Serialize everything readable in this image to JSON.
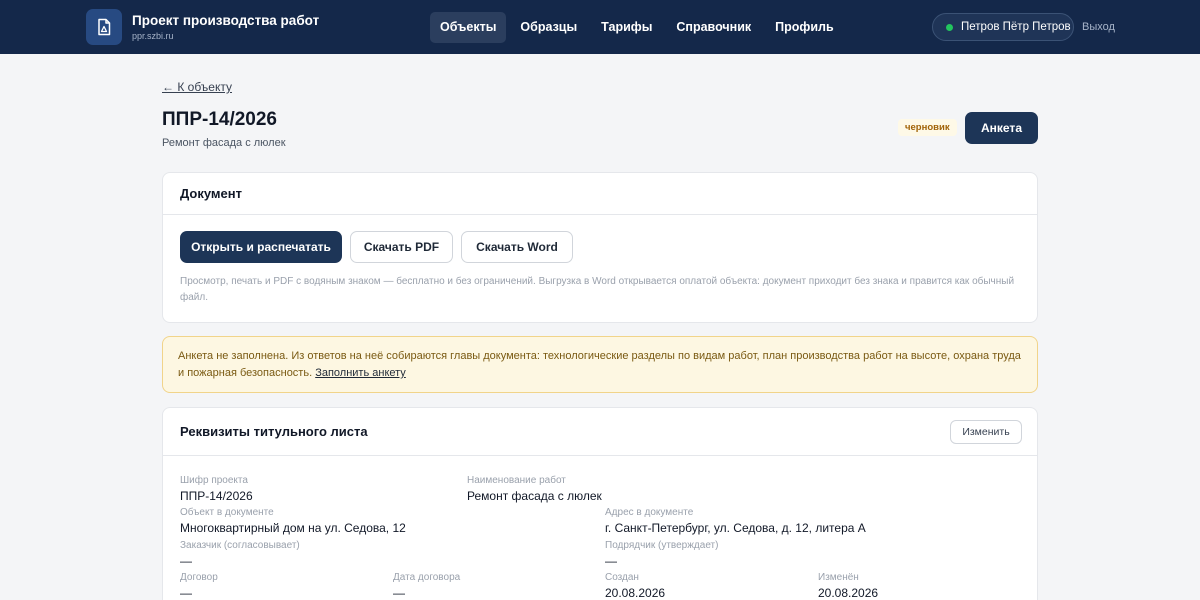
{
  "header": {
    "brand_title": "Проект производства работ",
    "brand_sub": "ppr.szbi.ru",
    "nav": [
      {
        "label": "Объекты",
        "active": true
      },
      {
        "label": "Образцы"
      },
      {
        "label": "Тарифы"
      },
      {
        "label": "Справочник"
      },
      {
        "label": "Профиль"
      }
    ],
    "user_name": "Петров Пётр Петров",
    "logout": "Выход"
  },
  "page": {
    "back": "← К объекту",
    "title": "ППР-14/2026",
    "subtitle": "Ремонт фасада с люлек",
    "status_badge": "черновик",
    "anketa_button": "Анкета"
  },
  "document": {
    "heading": "Документ",
    "open_print": "Открыть и распечатать",
    "download_pdf": "Скачать PDF",
    "download_word": "Скачать Word",
    "note": "Просмотр, печать и PDF с водяным знаком — бесплатно и без ограничений. Выгрузка в Word открывается оплатой объекта: документ приходит без знака и правится как обычный файл."
  },
  "warning": {
    "text": "Анкета не заполнена. Из ответов на неё собираются главы документа: технологические разделы по видам работ, план производства работ на высоте, охрана труда и пожарная безопасность.",
    "link": "Заполнить анкету"
  },
  "requisites": {
    "heading": "Реквизиты титульного листа",
    "edit_button": "Изменить",
    "fields": {
      "cipher": {
        "label": "Шифр проекта",
        "value": "ППР-14/2026"
      },
      "work_name": {
        "label": "Наименование работ",
        "value": "Ремонт фасада с люлек"
      },
      "object": {
        "label": "Объект в документе",
        "value": "Многоквартирный дом на ул. Седова, 12"
      },
      "address": {
        "label": "Адрес в документе",
        "value": "г. Санкт-Петербург, ул. Седова, д. 12, литера А"
      },
      "customer": {
        "label": "Заказчик (согласовывает)",
        "value": "—"
      },
      "contractor": {
        "label": "Подрядчик (утверждает)",
        "value": "—"
      },
      "contract": {
        "label": "Договор",
        "value": "—"
      },
      "contract_date": {
        "label": "Дата договора",
        "value": "—"
      },
      "created": {
        "label": "Создан",
        "value": "20.08.2026"
      },
      "modified": {
        "label": "Изменён",
        "value": "20.08.2026"
      }
    }
  }
}
